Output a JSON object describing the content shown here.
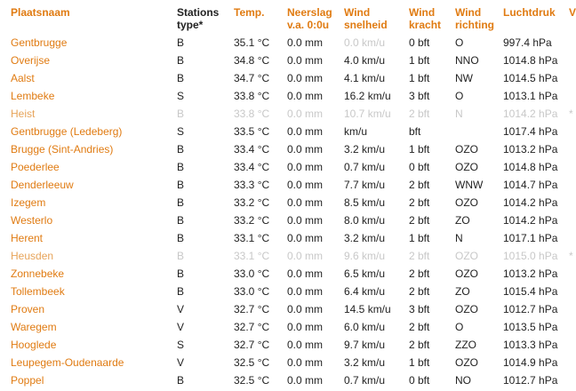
{
  "headers": {
    "location": "Plaatsnaam",
    "station_type_l1": "Stations",
    "station_type_l2": "type*",
    "temp": "Temp.",
    "rain_l1": "Neerslag",
    "rain_l2": "v.a. 0:0u",
    "wind_speed_l1": "Wind",
    "wind_speed_l2": "snelheid",
    "wind_force_l1": "Wind",
    "wind_force_l2": "kracht",
    "wind_dir_l1": "Wind",
    "wind_dir_l2": "richting",
    "pressure": "Luchtdruk",
    "visibility": "V"
  },
  "rows": [
    {
      "location": "Gentbrugge",
      "type": "B",
      "temp": "35.1 °C",
      "rain": "0.0 mm",
      "speed": "0.0 km/u",
      "force": "0 bft",
      "dir": "O",
      "pressure": "997.4 hPa",
      "extra": "",
      "stale": false,
      "speed_faded": true
    },
    {
      "location": "Overijse",
      "type": "B",
      "temp": "34.8 °C",
      "rain": "0.0 mm",
      "speed": "4.0 km/u",
      "force": "1 bft",
      "dir": "NNO",
      "pressure": "1014.8 hPa",
      "extra": "",
      "stale": false
    },
    {
      "location": "Aalst",
      "type": "B",
      "temp": "34.7 °C",
      "rain": "0.0 mm",
      "speed": "4.1 km/u",
      "force": "1 bft",
      "dir": "NW",
      "pressure": "1014.5 hPa",
      "extra": "",
      "stale": false
    },
    {
      "location": "Lembeke",
      "type": "S",
      "temp": "33.8 °C",
      "rain": "0.0 mm",
      "speed": "16.2 km/u",
      "force": "3 bft",
      "dir": "O",
      "pressure": "1013.1 hPa",
      "extra": "",
      "stale": false
    },
    {
      "location": "Heist",
      "type": "B",
      "temp": "33.8 °C",
      "rain": "0.0 mm",
      "speed": "10.7 km/u",
      "force": "2 bft",
      "dir": "N",
      "pressure": "1014.2 hPa",
      "extra": "*",
      "stale": true
    },
    {
      "location": "Gentbrugge (Ledeberg)",
      "type": "S",
      "temp": "33.5 °C",
      "rain": "0.0 mm",
      "speed": "km/u",
      "force": "bft",
      "dir": "",
      "pressure": "1017.4 hPa",
      "extra": "",
      "stale": false
    },
    {
      "location": "Brugge (Sint-Andries)",
      "type": "B",
      "temp": "33.4 °C",
      "rain": "0.0 mm",
      "speed": "3.2 km/u",
      "force": "1 bft",
      "dir": "OZO",
      "pressure": "1013.2 hPa",
      "extra": "",
      "stale": false
    },
    {
      "location": "Poederlee",
      "type": "B",
      "temp": "33.4 °C",
      "rain": "0.0 mm",
      "speed": "0.7 km/u",
      "force": "0 bft",
      "dir": "OZO",
      "pressure": "1014.8 hPa",
      "extra": "",
      "stale": false
    },
    {
      "location": "Denderleeuw",
      "type": "B",
      "temp": "33.3 °C",
      "rain": "0.0 mm",
      "speed": "7.7 km/u",
      "force": "2 bft",
      "dir": "WNW",
      "pressure": "1014.7 hPa",
      "extra": "",
      "stale": false
    },
    {
      "location": "Izegem",
      "type": "B",
      "temp": "33.2 °C",
      "rain": "0.0 mm",
      "speed": "8.5 km/u",
      "force": "2 bft",
      "dir": "OZO",
      "pressure": "1014.2 hPa",
      "extra": "",
      "stale": false
    },
    {
      "location": "Westerlo",
      "type": "B",
      "temp": "33.2 °C",
      "rain": "0.0 mm",
      "speed": "8.0 km/u",
      "force": "2 bft",
      "dir": "ZO",
      "pressure": "1014.2 hPa",
      "extra": "",
      "stale": false
    },
    {
      "location": "Herent",
      "type": "B",
      "temp": "33.1 °C",
      "rain": "0.0 mm",
      "speed": "3.2 km/u",
      "force": "1 bft",
      "dir": "N",
      "pressure": "1017.1 hPa",
      "extra": "",
      "stale": false
    },
    {
      "location": "Heusden",
      "type": "B",
      "temp": "33.1 °C",
      "rain": "0.0 mm",
      "speed": "9.6 km/u",
      "force": "2 bft",
      "dir": "OZO",
      "pressure": "1015.0 hPa",
      "extra": "*",
      "stale": true
    },
    {
      "location": "Zonnebeke",
      "type": "B",
      "temp": "33.0 °C",
      "rain": "0.0 mm",
      "speed": "6.5 km/u",
      "force": "2 bft",
      "dir": "OZO",
      "pressure": "1013.2 hPa",
      "extra": "",
      "stale": false
    },
    {
      "location": "Tollembeek",
      "type": "B",
      "temp": "33.0 °C",
      "rain": "0.0 mm",
      "speed": "6.4 km/u",
      "force": "2 bft",
      "dir": "ZO",
      "pressure": "1015.4 hPa",
      "extra": "",
      "stale": false
    },
    {
      "location": "Proven",
      "type": "V",
      "temp": "32.7 °C",
      "rain": "0.0 mm",
      "speed": "14.5 km/u",
      "force": "3 bft",
      "dir": "OZO",
      "pressure": "1012.7 hPa",
      "extra": "",
      "stale": false
    },
    {
      "location": "Waregem",
      "type": "V",
      "temp": "32.7 °C",
      "rain": "0.0 mm",
      "speed": "6.0 km/u",
      "force": "2 bft",
      "dir": "O",
      "pressure": "1013.5 hPa",
      "extra": "",
      "stale": false
    },
    {
      "location": "Hooglede",
      "type": "S",
      "temp": "32.7 °C",
      "rain": "0.0 mm",
      "speed": "9.7 km/u",
      "force": "2 bft",
      "dir": "ZZO",
      "pressure": "1013.3 hPa",
      "extra": "",
      "stale": false
    },
    {
      "location": "Leupegem-Oudenaarde",
      "type": "V",
      "temp": "32.5 °C",
      "rain": "0.0 mm",
      "speed": "3.2 km/u",
      "force": "1 bft",
      "dir": "OZO",
      "pressure": "1014.9 hPa",
      "extra": "",
      "stale": false
    },
    {
      "location": "Poppel",
      "type": "B",
      "temp": "32.5 °C",
      "rain": "0.0 mm",
      "speed": "0.7 km/u",
      "force": "0 bft",
      "dir": "NO",
      "pressure": "1012.7 hPa",
      "extra": "",
      "stale": false
    }
  ]
}
